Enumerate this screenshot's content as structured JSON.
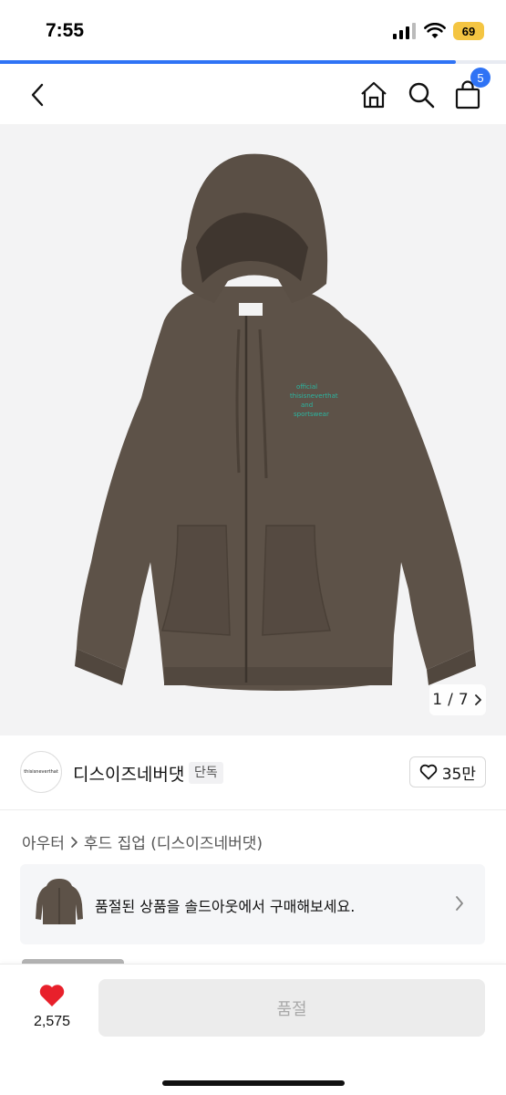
{
  "status_bar": {
    "time": "7:55",
    "battery": "69"
  },
  "progress": {
    "fraction": 0.9
  },
  "header": {
    "cart_count": "5"
  },
  "gallery": {
    "current": "1",
    "separator": "/",
    "total": "7"
  },
  "brand": {
    "name": "디스이즈네버댓",
    "badge": "단독",
    "logo_text": "thisisneverthat",
    "likes": "35만"
  },
  "breadcrumb": {
    "category": "아우터",
    "subcategory": "후드 집업 (디스이즈네버댓)"
  },
  "banner": {
    "text": "품절된 상품을 솔드아웃에서 구매해보세요."
  },
  "bottom_bar": {
    "wish_count": "2,575",
    "soldout_label": "품절"
  },
  "colors": {
    "accent": "#2f73f5",
    "heart": "#e8202b",
    "product": "#5e5349"
  },
  "icons": [
    "back-icon",
    "home-icon",
    "search-icon",
    "cart-icon",
    "heart-icon",
    "heart-outline-icon",
    "chevron-right-icon",
    "signal-icon",
    "wifi-icon"
  ]
}
